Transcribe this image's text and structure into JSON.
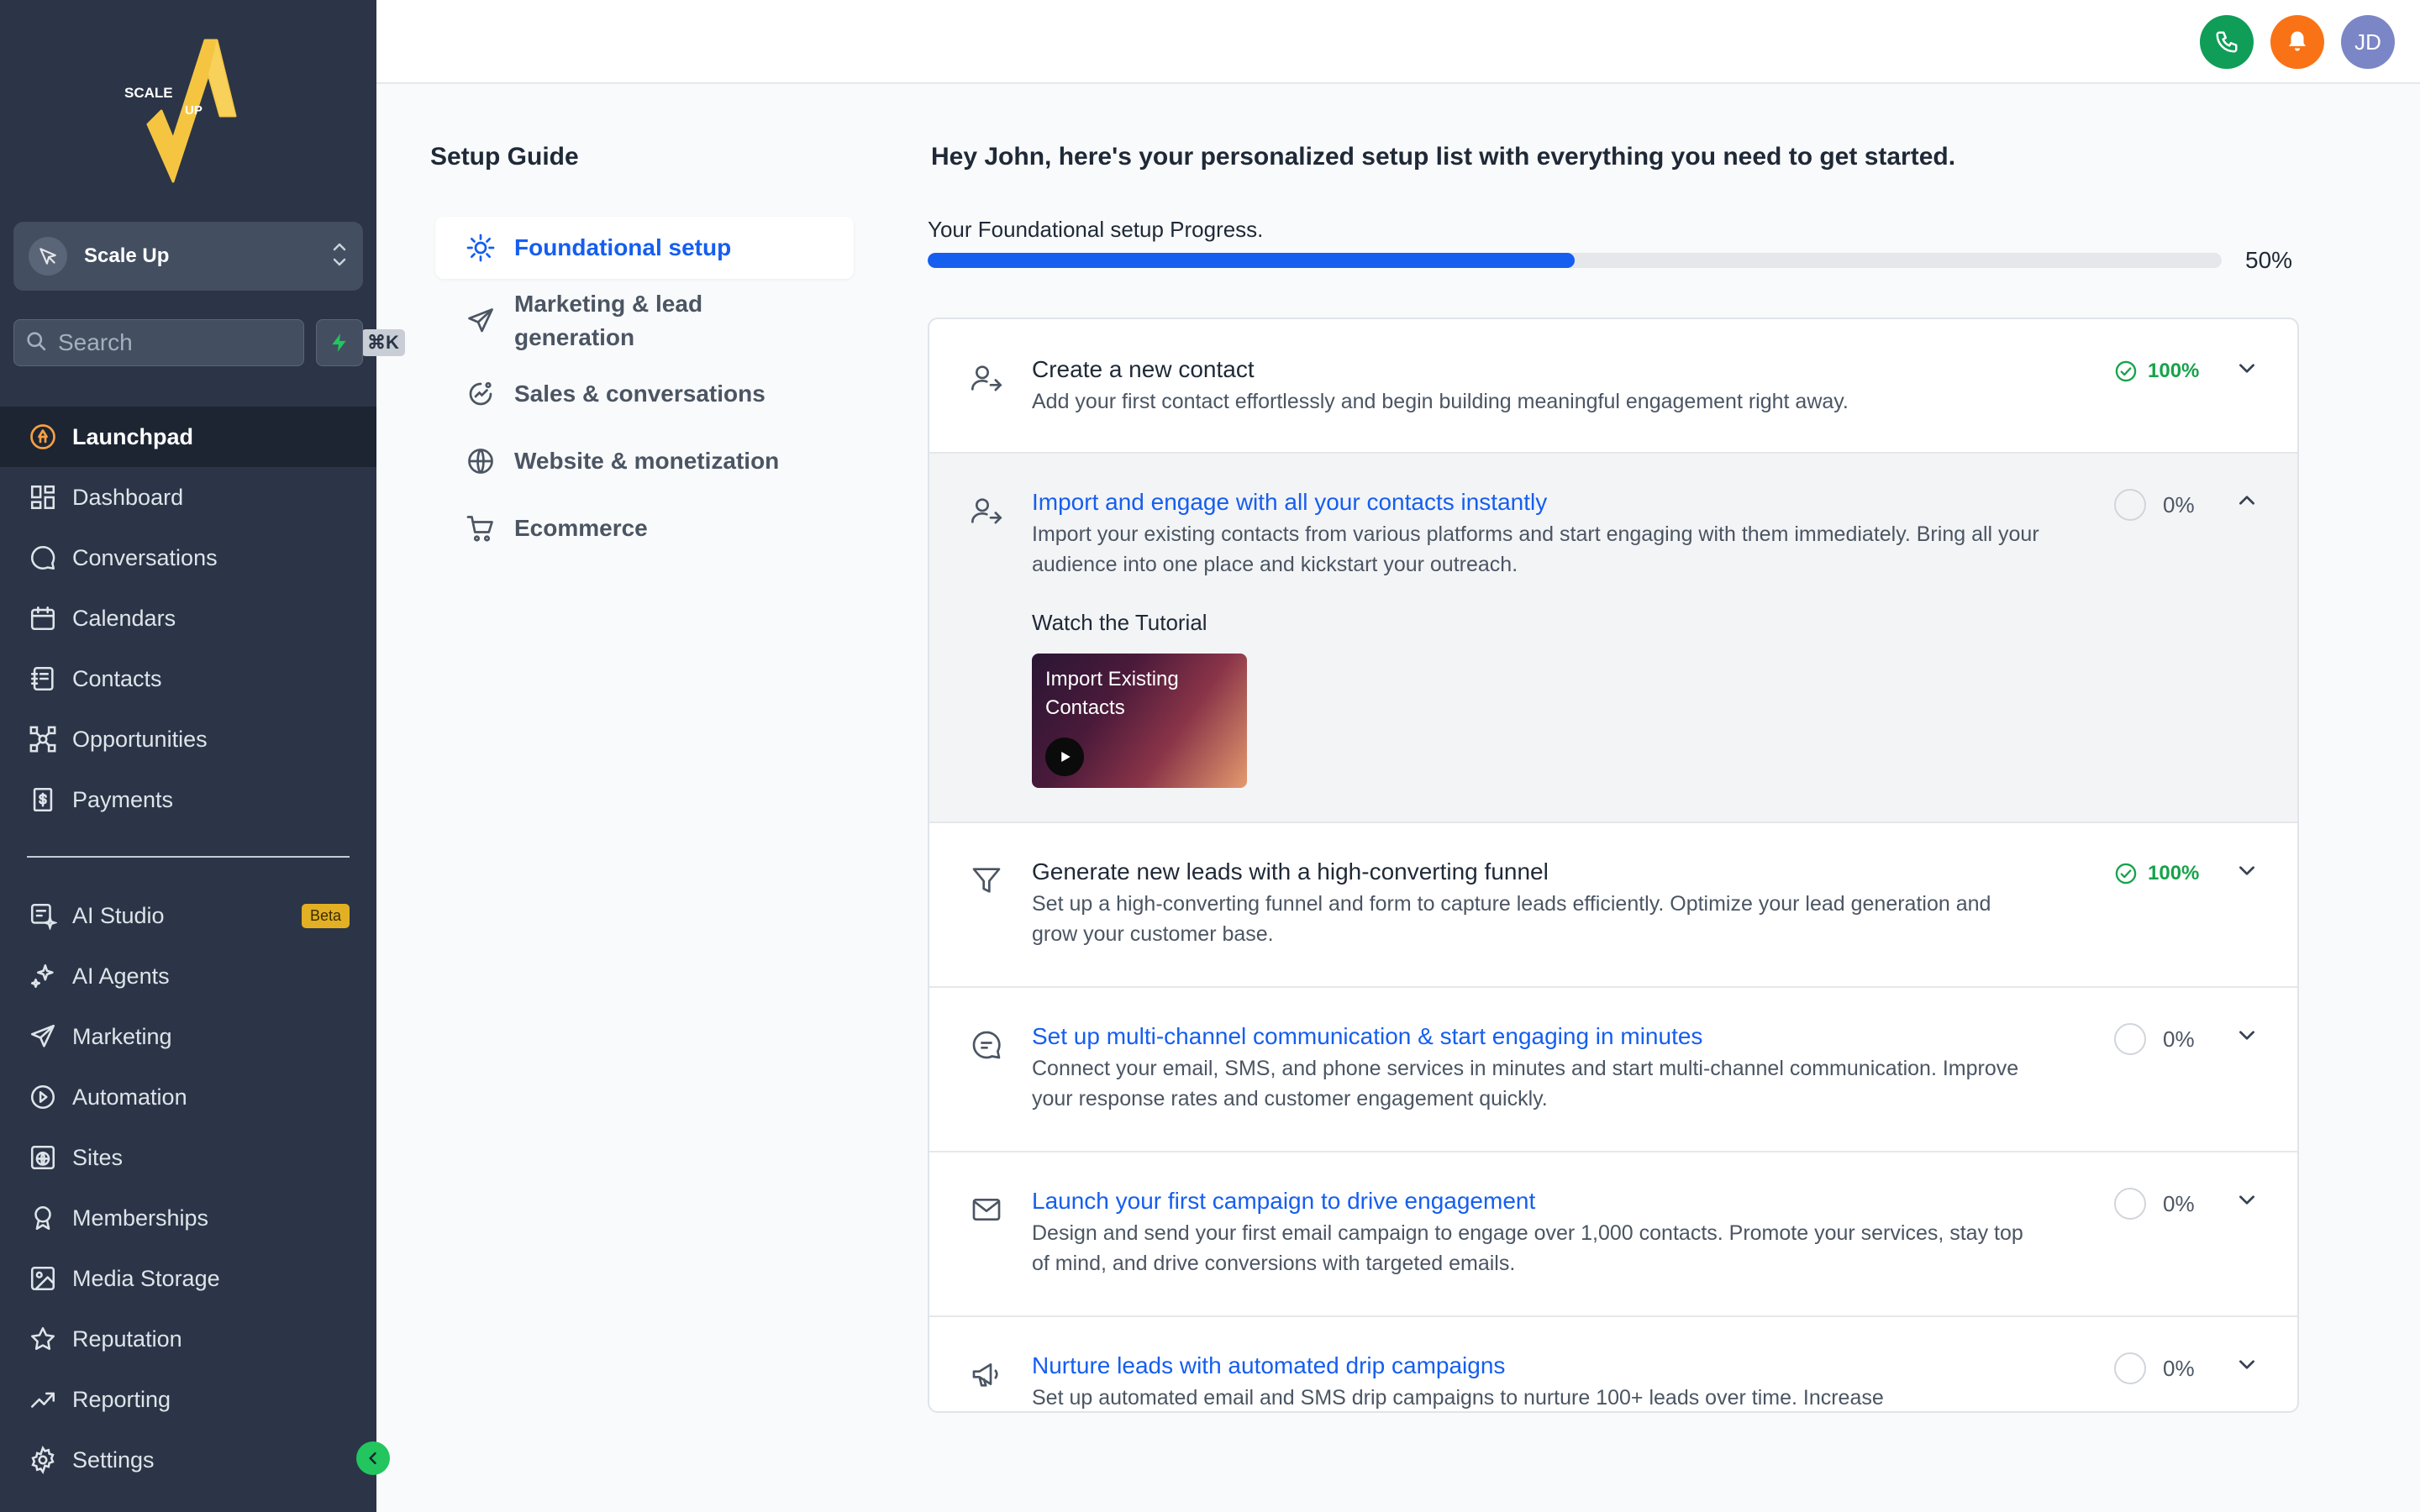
{
  "brand": {
    "logo_text_top": "SCALE",
    "logo_text_bottom": "UP"
  },
  "account": {
    "name": "Scale Up"
  },
  "search": {
    "placeholder": "Search",
    "shortcut": "⌘K"
  },
  "sidebar": {
    "primary": [
      {
        "label": "Launchpad",
        "icon": "rocket-icon",
        "active": true
      },
      {
        "label": "Dashboard",
        "icon": "grid-icon"
      },
      {
        "label": "Conversations",
        "icon": "chat-bubble-icon"
      },
      {
        "label": "Calendars",
        "icon": "calendar-icon"
      },
      {
        "label": "Contacts",
        "icon": "address-book-icon"
      },
      {
        "label": "Opportunities",
        "icon": "pipeline-icon"
      },
      {
        "label": "Payments",
        "icon": "invoice-icon"
      }
    ],
    "secondary": [
      {
        "label": "AI Studio",
        "icon": "ai-studio-icon",
        "badge": "Beta"
      },
      {
        "label": "AI Agents",
        "icon": "sparkle-icon"
      },
      {
        "label": "Marketing",
        "icon": "send-icon"
      },
      {
        "label": "Automation",
        "icon": "automation-icon"
      },
      {
        "label": "Sites",
        "icon": "globe-icon"
      },
      {
        "label": "Memberships",
        "icon": "badge-icon"
      },
      {
        "label": "Media Storage",
        "icon": "image-icon"
      },
      {
        "label": "Reputation",
        "icon": "star-icon"
      },
      {
        "label": "Reporting",
        "icon": "trend-icon"
      },
      {
        "label": "Settings",
        "icon": "gear-icon"
      }
    ]
  },
  "topbar": {
    "avatar_initials": "JD"
  },
  "guide": {
    "title": "Setup Guide",
    "items": [
      {
        "label": "Foundational setup",
        "icon": "sun-gear-icon",
        "active": true
      },
      {
        "label": "Marketing & lead generation",
        "icon": "paper-plane-icon"
      },
      {
        "label": "Sales & conversations",
        "icon": "sales-chart-icon"
      },
      {
        "label": "Website & monetization",
        "icon": "globe-dollar-icon"
      },
      {
        "label": "Ecommerce",
        "icon": "cart-icon"
      }
    ]
  },
  "main": {
    "greeting": "Hey John, here's your personalized setup list with everything you need to get started.",
    "progress_label": "Your Foundational setup Progress.",
    "progress_value": 50,
    "progress_text": "50%",
    "tasks": [
      {
        "title": "Create a new contact",
        "desc": "Add your first contact effortlessly and begin building meaningful engagement right away.",
        "status": "100%",
        "done": true,
        "icon": "user-add-icon"
      },
      {
        "title": "Import and engage with all your contacts instantly",
        "desc": "Import your existing contacts from various platforms and start engaging with them immediately. Bring all your audience into one place and kickstart your outreach.",
        "status": "0%",
        "done": false,
        "expanded": true,
        "icon": "user-import-icon",
        "tutorial_label": "Watch the Tutorial",
        "video_title": "Import Existing Contacts"
      },
      {
        "title": "Generate new leads with a high-converting funnel",
        "desc": "Set up a high-converting funnel and form to capture leads efficiently. Optimize your lead generation and grow your customer base.",
        "status": "100%",
        "done": true,
        "icon": "funnel-icon"
      },
      {
        "title": "Set up multi-channel communication & start engaging in minutes",
        "desc": "Connect your email, SMS, and phone services in minutes and start multi-channel communication. Improve your response rates and customer engagement quickly.",
        "status": "0%",
        "done": false,
        "icon": "message-dots-icon"
      },
      {
        "title": "Launch your first campaign to drive engagement",
        "desc": "Design and send your first email campaign to engage over 1,000 contacts. Promote your services, stay top of mind, and drive conversions with targeted emails.",
        "status": "0%",
        "done": false,
        "icon": "envelope-icon"
      },
      {
        "title": "Nurture leads with automated drip campaigns",
        "desc": "Set up automated email and SMS drip campaigns to nurture 100+ leads over time. Increase",
        "status": "0%",
        "done": false,
        "icon": "megaphone-icon"
      }
    ]
  },
  "colors": {
    "sidebar_bg": "#2b3547",
    "accent_blue": "#155eef",
    "success_green": "#16a34a",
    "phone_green": "#0f9d58",
    "bell_orange": "#f97316",
    "avatar_purple": "#7b86c6"
  }
}
